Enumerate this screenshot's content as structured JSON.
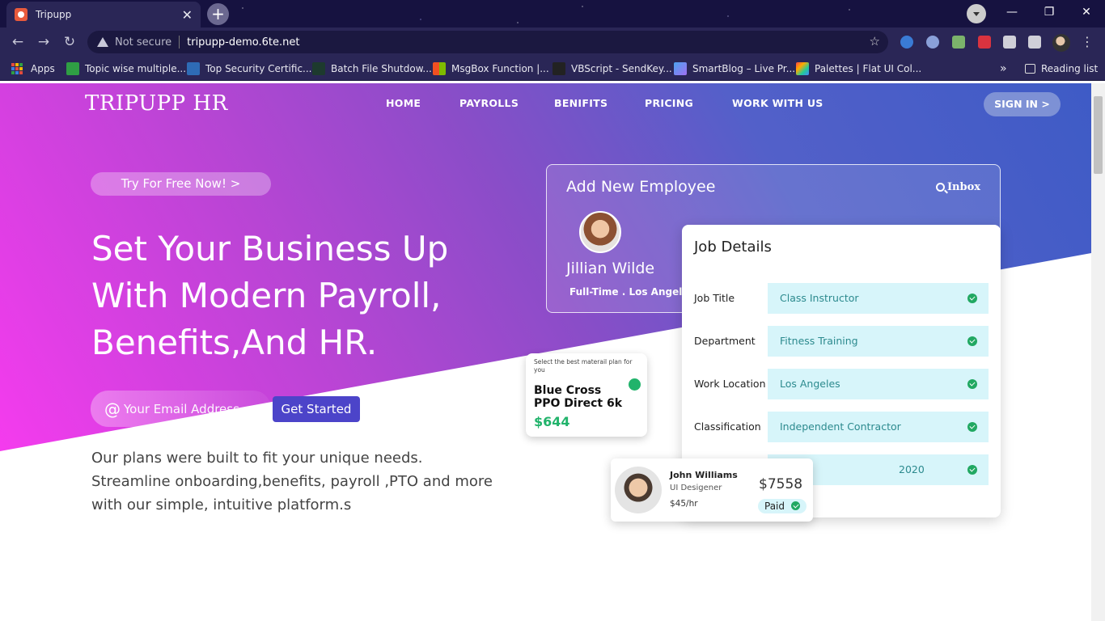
{
  "browser": {
    "tab_title": "Tripupp",
    "tab_close": "✕",
    "new_tab": "+",
    "not_secure": "Not secure",
    "url": "tripupp-demo.6te.net",
    "win_minimize": "—",
    "win_restore": "❐",
    "win_close": "✕",
    "back": "←",
    "forward": "→",
    "reload": "↻",
    "star": "☆",
    "menu": "⋮",
    "bookmarks": [
      {
        "label": "Apps"
      },
      {
        "label": "Topic wise multiple..."
      },
      {
        "label": "Top Security Certific..."
      },
      {
        "label": "Batch File Shutdow..."
      },
      {
        "label": "MsgBox Function |..."
      },
      {
        "label": "VBScript - SendKey..."
      },
      {
        "label": "SmartBlog – Live Pr..."
      },
      {
        "label": "Palettes | Flat UI Col..."
      }
    ],
    "more_bookmarks": "»",
    "reading_list": "Reading list"
  },
  "site": {
    "logo": "TRIPUPP HR",
    "nav": [
      "HOME",
      "PAYROLLS",
      "BENIFITS",
      "PRICING",
      "WORK WITH US"
    ],
    "sign_in": "SIGN IN >",
    "try_free": "Try For Free Now! >",
    "headline_lines": [
      "Set Your Business Up",
      "With Modern Payroll,",
      "Benefits,And HR."
    ],
    "email_at": "@",
    "email_placeholder": "Your Email Address",
    "get_started": "Get Started",
    "subtext": "Our plans were built to fit your unique needs. Streamline onboarding,benefits, payroll ,PTO and more with our simple, intuitive platform.s"
  },
  "add_employee": {
    "title": "Add New Employee",
    "inbox": "Inbox",
    "name": "Jillian Wilde",
    "meta": "Full-Time  .  Los Angeles"
  },
  "job_details": {
    "title": "Job Details",
    "rows": [
      {
        "label": "Job Title",
        "value": "Class Instructor"
      },
      {
        "label": "Department",
        "value": "Fitness Training"
      },
      {
        "label": "Work Location",
        "value": "Los Angeles"
      },
      {
        "label": "Classification",
        "value": "Independent Contractor"
      },
      {
        "label": "",
        "value": "2020"
      }
    ]
  },
  "plan": {
    "small_text": "Select the best materail plan for you",
    "name": "Blue Cross PPO Direct 6k",
    "price": "$644"
  },
  "payroll": {
    "name": "John Williams",
    "role": "UI Desigener",
    "rate": "$45/hr",
    "amount": "$7558",
    "status": "Paid"
  },
  "colors": {
    "accent": "#4c44c9",
    "success": "#21b36b",
    "chip_bg": "#d7f5fa"
  }
}
